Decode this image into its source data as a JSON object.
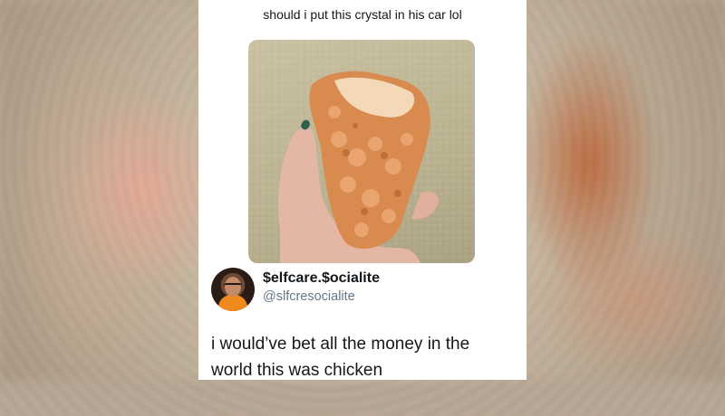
{
  "post": {
    "top_text": "should i put this crystal in his car lol",
    "image_description_icon": "crystal-photo"
  },
  "reply": {
    "display_name": "$elfcare.$ocialite",
    "handle": "@slfcresocialite",
    "text_line1": "i would’ve bet all the money in the",
    "text_line2": "world this was chicken"
  },
  "colors": {
    "background": "#ffffff",
    "text": "#14171a",
    "handle": "#657786",
    "avatar_shirt": "#f08a1c"
  }
}
